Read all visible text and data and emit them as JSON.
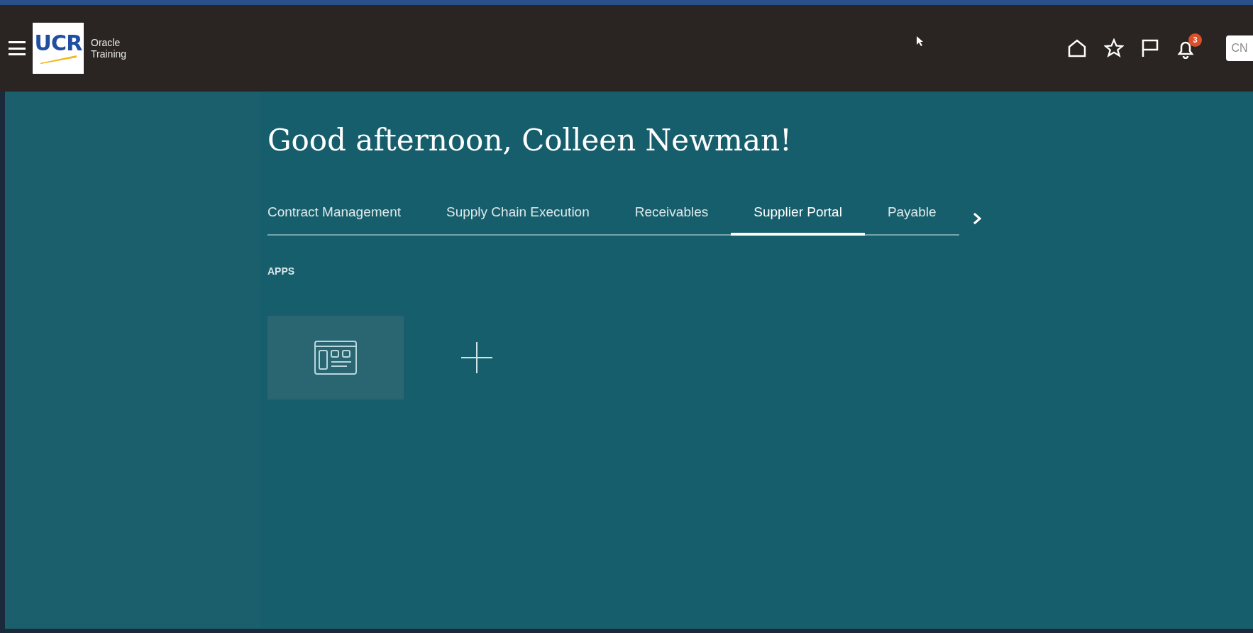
{
  "header": {
    "logo": "UCR",
    "app_name": [
      "Oracle",
      "Training"
    ],
    "notifications_count": "3",
    "user_initials": "CN"
  },
  "greeting": "Good afternoon, Colleen Newman!",
  "tabs": [
    {
      "label": "Contract Management",
      "selected": false
    },
    {
      "label": "Supply Chain Execution",
      "selected": false
    },
    {
      "label": "Receivables",
      "selected": false
    },
    {
      "label": "Supplier Portal",
      "selected": true
    },
    {
      "label": "Payable",
      "selected": false
    }
  ],
  "apps_heading": "APPS"
}
